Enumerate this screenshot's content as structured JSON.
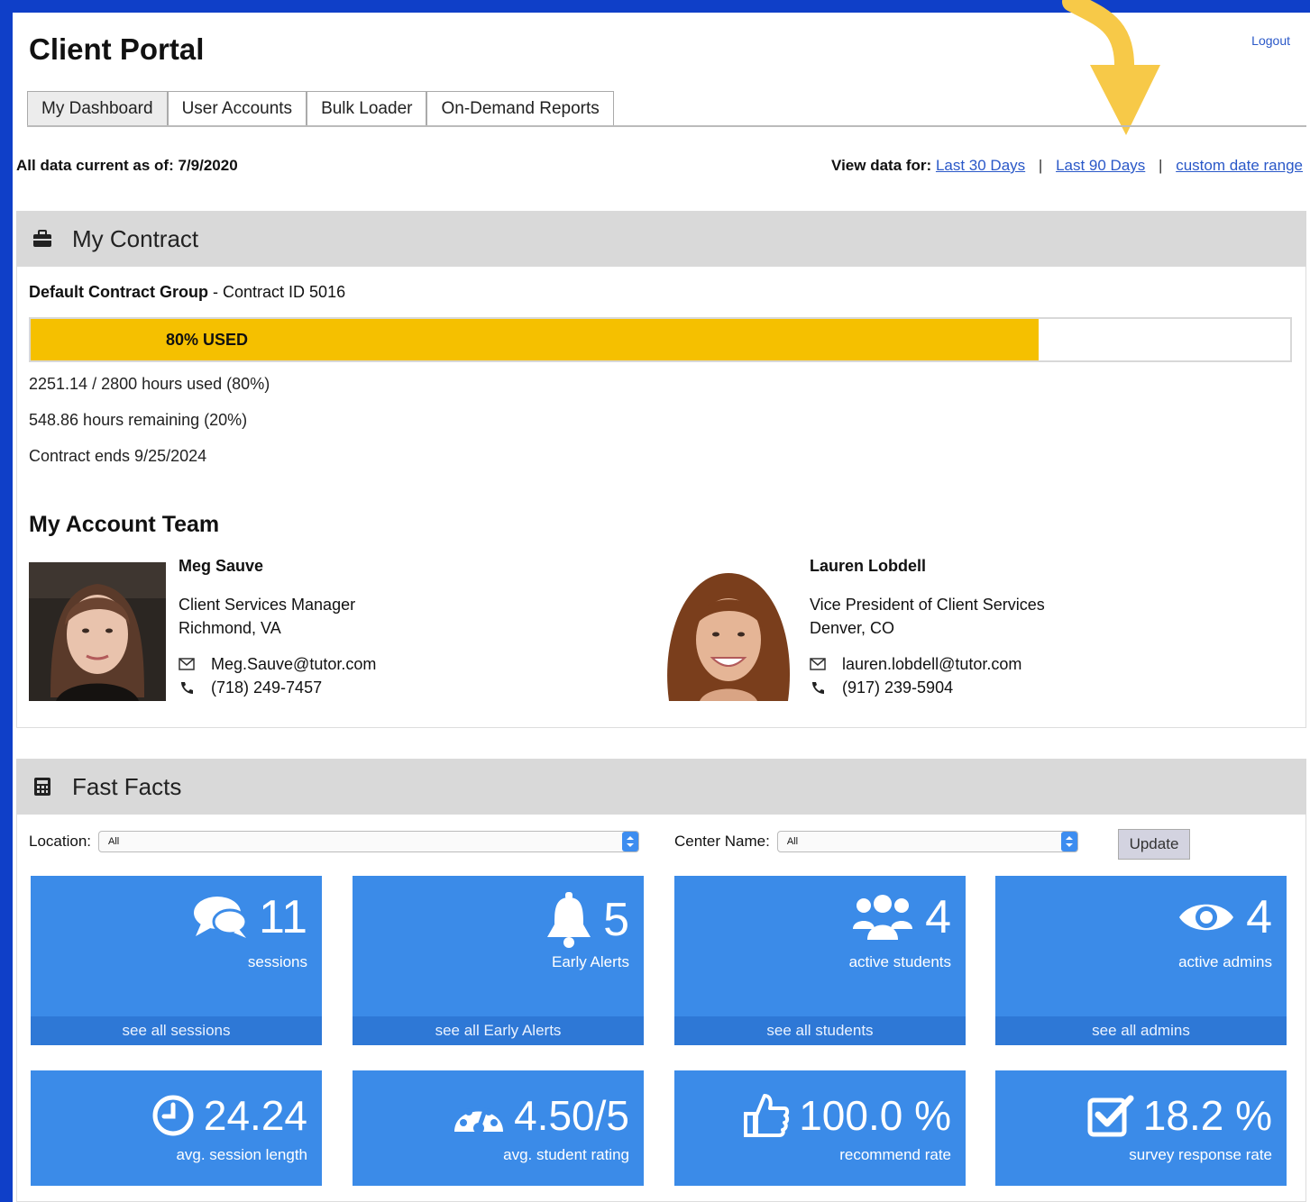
{
  "header": {
    "title": "Client Portal",
    "logout": "Logout"
  },
  "tabs": [
    {
      "label": "My Dashboard",
      "active": true
    },
    {
      "label": "User Accounts",
      "active": false
    },
    {
      "label": "Bulk Loader",
      "active": false
    },
    {
      "label": "On-Demand Reports",
      "active": false
    }
  ],
  "status": {
    "current_as_of": "All data current as of: 7/9/2020",
    "view_data_label": "View data for:",
    "ranges": [
      "Last 30 Days",
      "Last 90 Days",
      "custom date range"
    ]
  },
  "contract": {
    "heading": "My Contract",
    "group_name": "Default Contract Group",
    "contract_id": " - Contract ID 5016",
    "used_label": "80% USED",
    "used_fraction": 0.8,
    "hours_used": "2251.14 / 2800 hours used (80%)",
    "hours_remaining": "548.86 hours remaining (20%)",
    "contract_end": "Contract ends 9/25/2024"
  },
  "team": {
    "heading": "My Account Team",
    "members": [
      {
        "name": "Meg Sauve",
        "title": "Client Services Manager",
        "location": "Richmond, VA",
        "email": "Meg.Sauve@tutor.com",
        "phone": "(718) 249-7457"
      },
      {
        "name": "Lauren Lobdell",
        "title": "Vice President of Client Services",
        "location": "Denver, CO",
        "email": "lauren.lobdell@tutor.com",
        "phone": "(917) 239-5904"
      }
    ]
  },
  "fast_facts": {
    "heading": "Fast Facts",
    "location_label": "Location:",
    "location_value": "All",
    "center_label": "Center Name:",
    "center_value": "All",
    "update_label": "Update",
    "tiles": [
      {
        "icon": "chat-bubbles-icon",
        "value": "11",
        "label": "sessions",
        "link": "see all sessions"
      },
      {
        "icon": "bell-icon",
        "value": "5",
        "label": "Early Alerts",
        "link": "see all Early Alerts"
      },
      {
        "icon": "users-icon",
        "value": "4",
        "label": "active students",
        "link": "see all students"
      },
      {
        "icon": "eye-icon",
        "value": "4",
        "label": "active admins",
        "link": "see all admins"
      }
    ],
    "metrics": [
      {
        "icon": "clock-icon",
        "value": "24.24",
        "label": "avg. session length"
      },
      {
        "icon": "gauge-icon",
        "value": "4.50/5",
        "label": "avg. student rating"
      },
      {
        "icon": "thumbs-up-icon",
        "value": "100.0 %",
        "label": "recommend rate"
      },
      {
        "icon": "checkbox-icon",
        "value": "18.2 %",
        "label": "survey response rate"
      }
    ]
  },
  "colors": {
    "frame": "#0f3fc8",
    "tile": "#3b8be8",
    "progress": "#f5c000",
    "arrow": "#f7c948"
  }
}
